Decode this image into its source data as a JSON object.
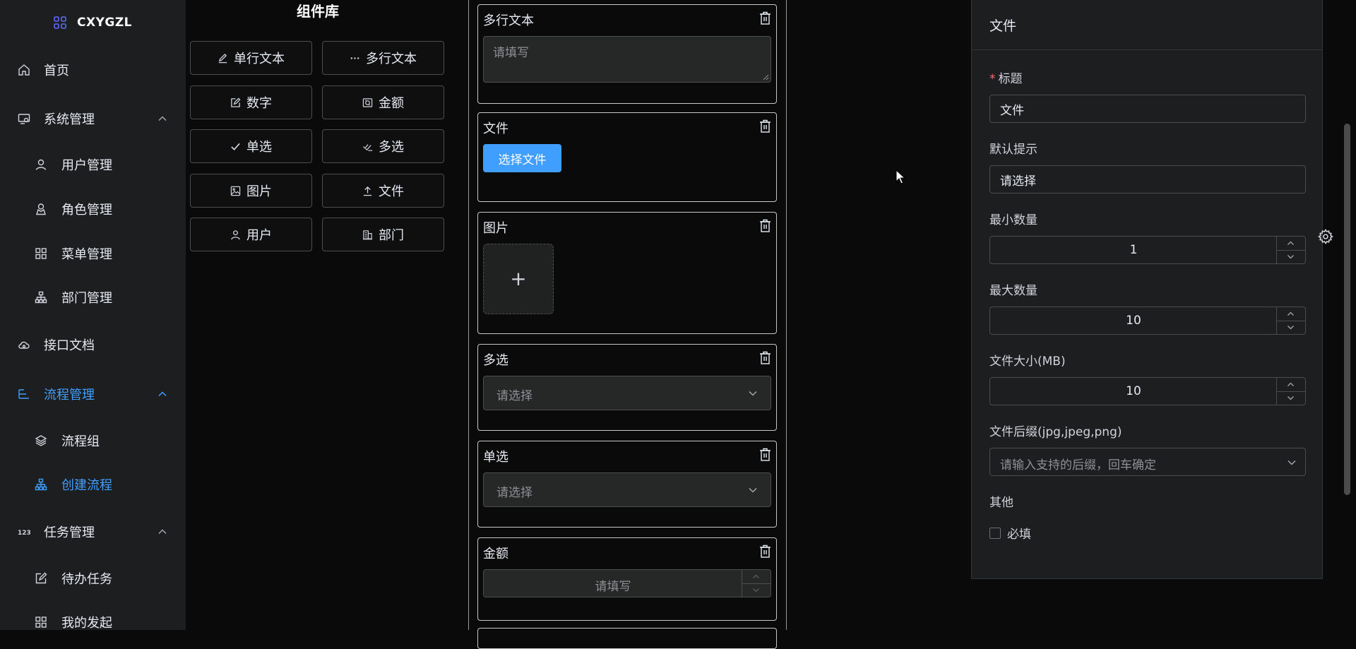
{
  "app": {
    "name": "CXYGZL"
  },
  "sidebar": {
    "items": [
      {
        "label": "首页",
        "icon": "home-icon",
        "level": 1
      },
      {
        "label": "系统管理",
        "icon": "system-settings-icon",
        "level": 1,
        "expanded": true
      },
      {
        "label": "用户管理",
        "icon": "user-icon",
        "level": 2
      },
      {
        "label": "角色管理",
        "icon": "role-icon",
        "level": 2
      },
      {
        "label": "菜单管理",
        "icon": "menu-grid-icon",
        "level": 2
      },
      {
        "label": "部门管理",
        "icon": "org-tree-icon",
        "level": 2
      },
      {
        "label": "接口文档",
        "icon": "cloud-api-icon",
        "level": 1
      },
      {
        "label": "流程管理",
        "icon": "flow-icon",
        "level": 1,
        "expanded": true,
        "active": true
      },
      {
        "label": "流程组",
        "icon": "layers-icon",
        "level": 2
      },
      {
        "label": "创建流程",
        "icon": "org-tree-icon",
        "level": 2,
        "active": true
      },
      {
        "label": "任务管理",
        "icon": "123-icon",
        "level": 1,
        "expanded": true
      },
      {
        "label": "待办任务",
        "icon": "edit-icon",
        "level": 2
      },
      {
        "label": "我的发起",
        "icon": "menu-grid-icon",
        "level": 2
      }
    ]
  },
  "library": {
    "title": "组件库",
    "components": [
      {
        "label": "单行文本",
        "icon": "pen-icon"
      },
      {
        "label": "多行文本",
        "icon": "ellipsis-icon"
      },
      {
        "label": "数字",
        "icon": "edit-icon"
      },
      {
        "label": "金额",
        "icon": "money-icon"
      },
      {
        "label": "单选",
        "icon": "check-icon"
      },
      {
        "label": "多选",
        "icon": "multi-check-icon"
      },
      {
        "label": "图片",
        "icon": "image-icon"
      },
      {
        "label": "文件",
        "icon": "upload-icon"
      },
      {
        "label": "用户",
        "icon": "user-icon"
      },
      {
        "label": "部门",
        "icon": "office-building-icon"
      }
    ]
  },
  "canvas": {
    "textarea": {
      "title": "多行文本",
      "placeholder": "请填写"
    },
    "file": {
      "title": "文件",
      "button": "选择文件"
    },
    "image": {
      "title": "图片",
      "plus": "+"
    },
    "multi": {
      "title": "多选",
      "placeholder": "请选择"
    },
    "single": {
      "title": "单选",
      "placeholder": "请选择"
    },
    "money": {
      "title": "金额",
      "placeholder": "请填写"
    }
  },
  "panel": {
    "title": "文件",
    "title_label": "标题",
    "title_value": "文件",
    "hint_label": "默认提示",
    "hint_value": "请选择",
    "min_label": "最小数量",
    "min_value": "1",
    "max_label": "最大数量",
    "max_value": "10",
    "size_label": "文件大小(MB)",
    "size_value": "10",
    "suffix_label": "文件后缀(jpg,jpeg,png)",
    "suffix_placeholder": "请输入支持的后缀，回车确定",
    "other_label": "其他",
    "required_label": "必填",
    "required_checked": false
  },
  "colors": {
    "accent": "#409eff",
    "danger": "#f56c6c",
    "bg": "#0a0a0a",
    "panel_bg": "#1d1e1f"
  }
}
